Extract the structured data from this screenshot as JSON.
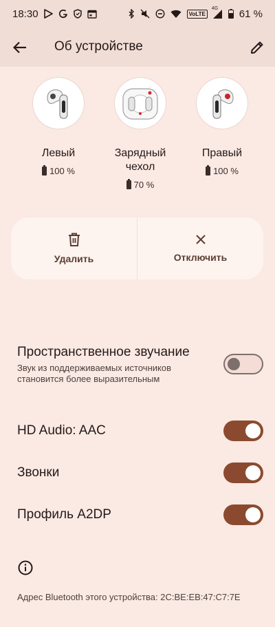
{
  "status_bar": {
    "time": "18:30",
    "network": "4G",
    "volte": "VoLTE",
    "battery": "61 %"
  },
  "header": {
    "title": "Об устройстве"
  },
  "devices": [
    {
      "name": "Левый",
      "battery": "100 %"
    },
    {
      "name": "Зарядный чехол",
      "battery": "70 %"
    },
    {
      "name": "Правый",
      "battery": "100 %"
    }
  ],
  "actions": {
    "remove_label": "Удалить",
    "disconnect_label": "Отключить"
  },
  "settings": {
    "spatial": {
      "title": "Пространственное звучание",
      "subtitle": "Звук из поддерживаемых источников становится более выразительным",
      "enabled": false
    },
    "hd_audio": {
      "title": "HD Audio: AAC",
      "enabled": true
    },
    "calls": {
      "title": "Звонки",
      "enabled": true
    },
    "a2dp": {
      "title": "Профиль A2DP",
      "enabled": true
    }
  },
  "footer": {
    "bt_address": "Адрес Bluetooth этого устройства: 2C:BE:EB:47:C7:7E"
  },
  "colors": {
    "background": "#fbe9e3",
    "bar": "#f0ddd6",
    "switch_on": "#8b4a2f",
    "card": "#fdf3ef"
  }
}
